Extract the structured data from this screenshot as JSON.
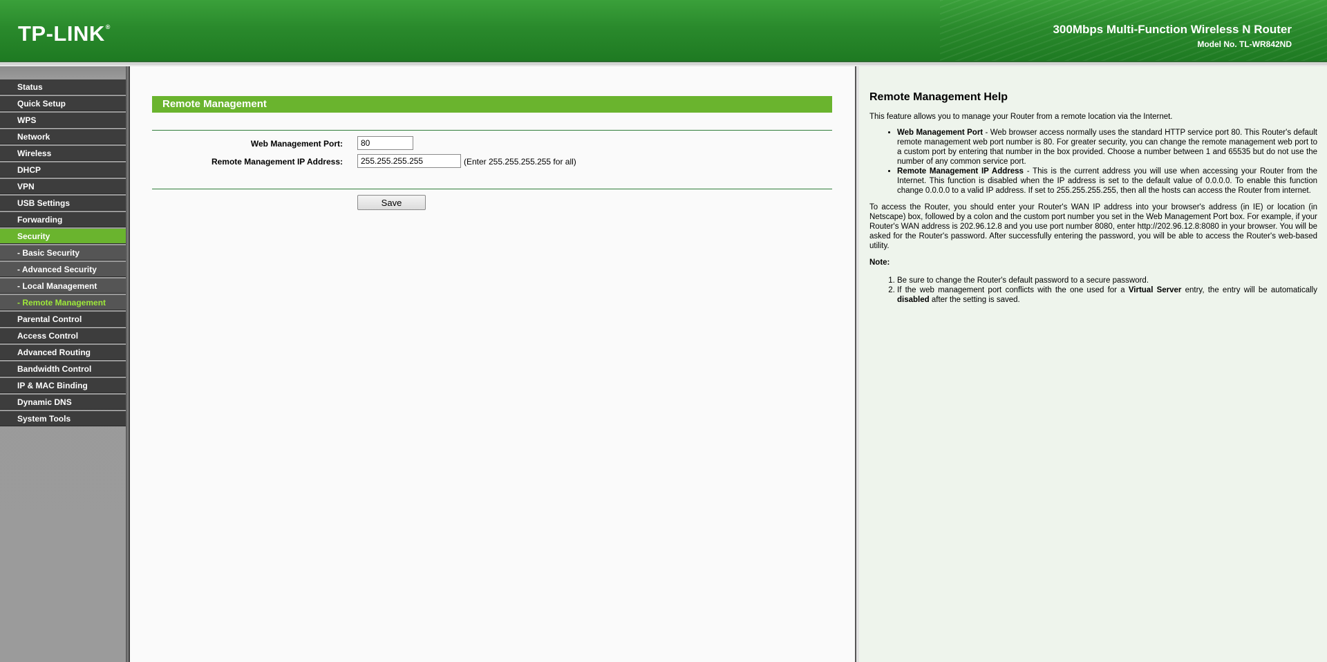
{
  "header": {
    "logo_text": "TP-LINK",
    "logo_tm": "®",
    "product_title": "300Mbps Multi-Function Wireless N Router",
    "model_no": "Model No. TL-WR842ND"
  },
  "colors": {
    "header_green": "#2a8a2c",
    "active_green": "#6ab42e",
    "menu_dark": "#3d3d3d",
    "submenu_active_text": "#9ee83a"
  },
  "sidebar": {
    "items": [
      {
        "label": "Status",
        "type": "item"
      },
      {
        "label": "Quick Setup",
        "type": "item"
      },
      {
        "label": "WPS",
        "type": "item"
      },
      {
        "label": "Network",
        "type": "item"
      },
      {
        "label": "Wireless",
        "type": "item"
      },
      {
        "label": "DHCP",
        "type": "item"
      },
      {
        "label": "VPN",
        "type": "item"
      },
      {
        "label": "USB Settings",
        "type": "item"
      },
      {
        "label": "Forwarding",
        "type": "item"
      },
      {
        "label": "Security",
        "type": "active"
      },
      {
        "label": "- Basic Security",
        "type": "sub"
      },
      {
        "label": "- Advanced Security",
        "type": "sub"
      },
      {
        "label": "- Local Management",
        "type": "sub"
      },
      {
        "label": "- Remote Management",
        "type": "sub-active"
      },
      {
        "label": "Parental Control",
        "type": "item"
      },
      {
        "label": "Access Control",
        "type": "item"
      },
      {
        "label": "Advanced Routing",
        "type": "item"
      },
      {
        "label": "Bandwidth Control",
        "type": "item"
      },
      {
        "label": "IP & MAC Binding",
        "type": "item"
      },
      {
        "label": "Dynamic DNS",
        "type": "item"
      },
      {
        "label": "System Tools",
        "type": "item"
      }
    ]
  },
  "main": {
    "section_title": "Remote Management",
    "web_port_label": "Web Management Port:",
    "web_port_value": "80",
    "ip_label": "Remote Management IP Address:",
    "ip_value": "255.255.255.255",
    "ip_hint": "(Enter 255.255.255.255 for all)",
    "save_label": "Save"
  },
  "help": {
    "title": "Remote Management Help",
    "intro": "This feature allows you to manage your Router from a remote location via the Internet.",
    "bullets": [
      {
        "term": "Web Management Port",
        "text": " - Web browser access normally uses the standard HTTP service port 80. This Router's default remote management web port number is 80. For greater security, you can change the remote management web port to a custom port by entering that number in the box provided. Choose a number between 1 and 65535 but do not use the number of any common service port."
      },
      {
        "term": "Remote Management IP Address",
        "text": " - This is the current address you will use when accessing your Router from the Internet. This function is disabled when the IP address is set to the default value of 0.0.0.0. To enable this function change 0.0.0.0 to a valid IP address. If set to 255.255.255.255, then all the hosts can access the Router from internet."
      }
    ],
    "access_paragraph": "To access the Router, you should enter your Router's WAN IP address into your browser's address (in IE) or location (in Netscape) box, followed by a colon and the custom port number you set in the Web Management Port box. For example, if your Router's WAN address is 202.96.12.8 and you use port number 8080, enter http://202.96.12.8:8080 in your browser. You will be asked for the Router's password. After successfully entering the password, you will be able to access the Router's web-based utility.",
    "note_title": "Note:",
    "notes": {
      "n1": "Be sure to change the Router's default password to a secure password.",
      "n2_a": "If the web management port conflicts with the one used for a ",
      "n2_b": "Virtual Server",
      "n2_c": " entry, the entry will be automatically ",
      "n2_d": "disabled",
      "n2_e": " after the setting is saved."
    }
  }
}
